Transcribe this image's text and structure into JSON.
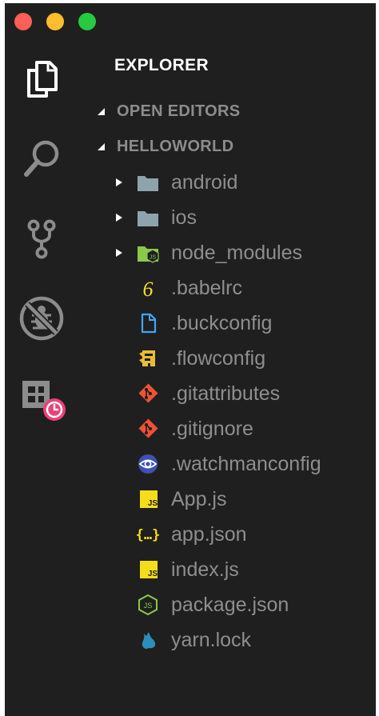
{
  "window": {
    "controls": {
      "close_color": "#fe5f57",
      "minimize_color": "#febc2e",
      "maximize_color": "#28c840"
    }
  },
  "activity_bar": {
    "items": [
      {
        "icon": "files-icon",
        "active": true
      },
      {
        "icon": "search-icon",
        "active": false
      },
      {
        "icon": "source-control-icon",
        "active": false
      },
      {
        "icon": "debug-icon",
        "active": false
      },
      {
        "icon": "extension-clock-icon",
        "active": false
      }
    ]
  },
  "sidebar": {
    "title": "EXPLORER",
    "sections": {
      "open_editors": {
        "label": "OPEN EDITORS",
        "expanded": true
      },
      "project": {
        "label": "HELLOWORLD",
        "expanded": true
      }
    },
    "tree": [
      {
        "name": "android",
        "type": "folder",
        "icon": "folder-icon"
      },
      {
        "name": "ios",
        "type": "folder",
        "icon": "folder-icon"
      },
      {
        "name": "node_modules",
        "type": "folder",
        "icon": "node-folder-icon"
      },
      {
        "name": ".babelrc",
        "type": "file",
        "icon": "babel-icon"
      },
      {
        "name": ".buckconfig",
        "type": "file",
        "icon": "file-icon"
      },
      {
        "name": ".flowconfig",
        "type": "file",
        "icon": "flow-icon"
      },
      {
        "name": ".gitattributes",
        "type": "file",
        "icon": "git-icon"
      },
      {
        "name": ".gitignore",
        "type": "file",
        "icon": "git-icon"
      },
      {
        "name": ".watchmanconfig",
        "type": "file",
        "icon": "watchman-icon"
      },
      {
        "name": "App.js",
        "type": "file",
        "icon": "javascript-icon"
      },
      {
        "name": "app.json",
        "type": "file",
        "icon": "json-icon"
      },
      {
        "name": "index.js",
        "type": "file",
        "icon": "javascript-icon"
      },
      {
        "name": "package.json",
        "type": "file",
        "icon": "nodejs-icon"
      },
      {
        "name": "yarn.lock",
        "type": "file",
        "icon": "yarn-icon"
      }
    ]
  },
  "colors": {
    "background": "#1f1f1f",
    "title_text": "#ffffff",
    "section_text": "#8c8c8c",
    "item_text": "#8e8e8e",
    "folder": "#8fa3ad",
    "node_green": "#8cc84b",
    "javascript_yellow": "#f5de19",
    "git_orange": "#f05133",
    "file_blue": "#42a5f5",
    "watchman_blue": "#3f51b5",
    "badge_pink": "#ec407a"
  }
}
